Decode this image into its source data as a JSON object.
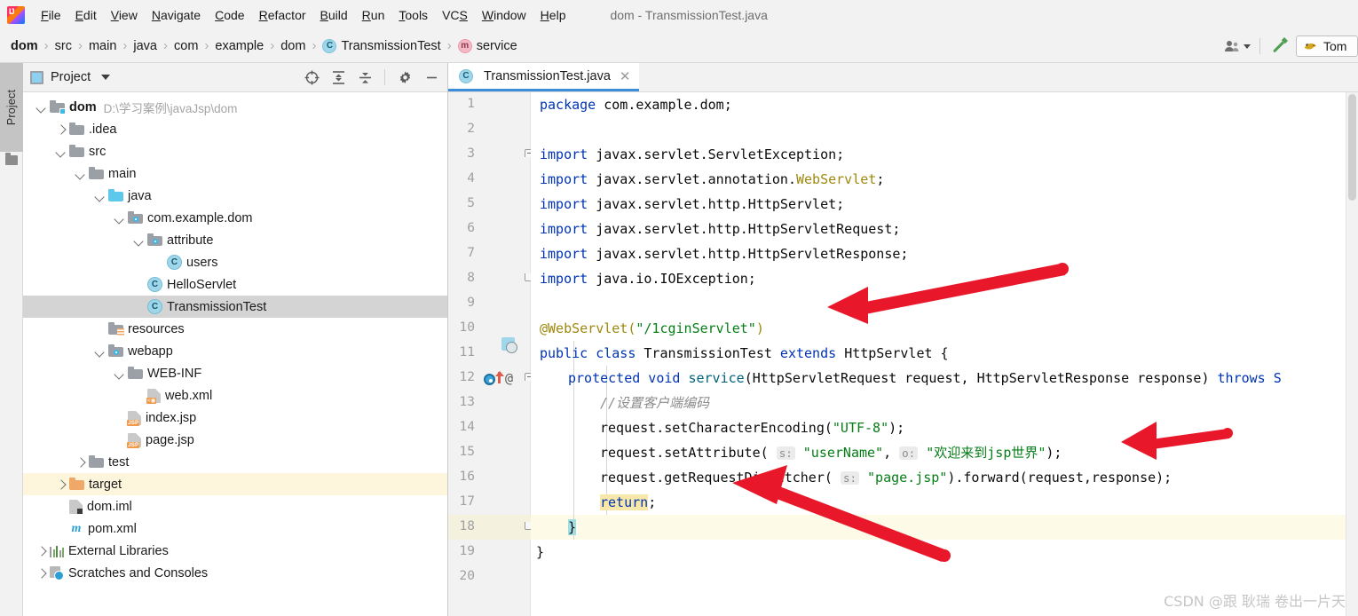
{
  "window": {
    "title": "dom - TransmissionTest.java",
    "app_icon": "intellij-idea-logo"
  },
  "menubar": {
    "items": [
      {
        "label": "File",
        "mnemonic": "F"
      },
      {
        "label": "Edit",
        "mnemonic": "E"
      },
      {
        "label": "View",
        "mnemonic": "V"
      },
      {
        "label": "Navigate",
        "mnemonic": "N"
      },
      {
        "label": "Code",
        "mnemonic": "C"
      },
      {
        "label": "Refactor",
        "mnemonic": "R"
      },
      {
        "label": "Build",
        "mnemonic": "B"
      },
      {
        "label": "Run",
        "mnemonic": "R"
      },
      {
        "label": "Tools",
        "mnemonic": "T"
      },
      {
        "label": "VCS",
        "mnemonic": "S"
      },
      {
        "label": "Window",
        "mnemonic": "W"
      },
      {
        "label": "Help",
        "mnemonic": "H"
      }
    ]
  },
  "breadcrumb": {
    "separator": "›",
    "items": [
      {
        "label": "dom",
        "kind": "module"
      },
      {
        "label": "src",
        "kind": "folder"
      },
      {
        "label": "main",
        "kind": "folder"
      },
      {
        "label": "java",
        "kind": "folder"
      },
      {
        "label": "com",
        "kind": "package"
      },
      {
        "label": "example",
        "kind": "package"
      },
      {
        "label": "dom",
        "kind": "package"
      },
      {
        "label": "TransmissionTest",
        "kind": "class",
        "badge": "C"
      },
      {
        "label": "service",
        "kind": "method",
        "badge": "m"
      }
    ]
  },
  "toolbar_right": {
    "user_icon": "user-silhouette-icon",
    "user_dropdown_icon": "chevron-down-icon",
    "build_icon": "hammer-icon",
    "run_config": {
      "label": "Tom",
      "icon": "tomcat-cat-icon"
    }
  },
  "tool_window_strip": {
    "project_tab": "Project",
    "structure_icon": "folder-icon"
  },
  "project_panel": {
    "title": "Project",
    "title_icon": "project-view-icon",
    "dropdown_icon": "chevron-down-icon",
    "toolbar": [
      {
        "name": "select-opened-file-icon",
        "glyph": "target"
      },
      {
        "name": "expand-all-icon",
        "glyph": "expand"
      },
      {
        "name": "collapse-all-icon",
        "glyph": "collapse"
      },
      {
        "name": "settings-gear-icon",
        "glyph": "gear"
      },
      {
        "name": "hide-panel-icon",
        "glyph": "minus"
      }
    ],
    "tree": [
      {
        "label": "dom",
        "sub": "D:\\学习案例\\javaJsp\\dom",
        "depth": 0,
        "arrow": "down",
        "icon": "module-folder",
        "bold": true,
        "state": "normal"
      },
      {
        "label": ".idea",
        "sub": "",
        "depth": 1,
        "arrow": "right",
        "icon": "folder-gray",
        "bold": false,
        "state": "normal"
      },
      {
        "label": "src",
        "sub": "",
        "depth": 1,
        "arrow": "down",
        "icon": "folder-gray",
        "bold": false,
        "state": "normal"
      },
      {
        "label": "main",
        "sub": "",
        "depth": 2,
        "arrow": "down",
        "icon": "folder-gray",
        "bold": false,
        "state": "normal"
      },
      {
        "label": "java",
        "sub": "",
        "depth": 3,
        "arrow": "down",
        "icon": "folder-blue",
        "bold": false,
        "state": "normal"
      },
      {
        "label": "com.example.dom",
        "sub": "",
        "depth": 4,
        "arrow": "down",
        "icon": "package",
        "bold": false,
        "state": "normal"
      },
      {
        "label": "attribute",
        "sub": "",
        "depth": 5,
        "arrow": "down",
        "icon": "package",
        "bold": false,
        "state": "normal"
      },
      {
        "label": "users",
        "sub": "",
        "depth": 6,
        "arrow": "none",
        "icon": "class",
        "bold": false,
        "state": "normal"
      },
      {
        "label": "HelloServlet",
        "sub": "",
        "depth": 5,
        "arrow": "none",
        "icon": "class",
        "bold": false,
        "state": "normal"
      },
      {
        "label": "TransmissionTest",
        "sub": "",
        "depth": 5,
        "arrow": "none",
        "icon": "class",
        "bold": false,
        "state": "selected"
      },
      {
        "label": "resources",
        "sub": "",
        "depth": 3,
        "arrow": "none",
        "icon": "folder-resources",
        "bold": false,
        "state": "normal"
      },
      {
        "label": "webapp",
        "sub": "",
        "depth": 3,
        "arrow": "down",
        "icon": "folder-webapp",
        "bold": false,
        "state": "normal"
      },
      {
        "label": "WEB-INF",
        "sub": "",
        "depth": 4,
        "arrow": "down",
        "icon": "folder-gray",
        "bold": false,
        "state": "normal"
      },
      {
        "label": "web.xml",
        "sub": "",
        "depth": 5,
        "arrow": "none",
        "icon": "file-xml",
        "bold": false,
        "state": "normal"
      },
      {
        "label": "index.jsp",
        "sub": "",
        "depth": 4,
        "arrow": "none",
        "icon": "file-jsp",
        "bold": false,
        "state": "normal"
      },
      {
        "label": "page.jsp",
        "sub": "",
        "depth": 4,
        "arrow": "none",
        "icon": "file-jsp",
        "bold": false,
        "state": "normal"
      },
      {
        "label": "test",
        "sub": "",
        "depth": 2,
        "arrow": "right",
        "icon": "folder-gray",
        "bold": false,
        "state": "normal"
      },
      {
        "label": "target",
        "sub": "",
        "depth": 1,
        "arrow": "right",
        "icon": "folder-orange",
        "bold": false,
        "state": "highlighted"
      },
      {
        "label": "dom.iml",
        "sub": "",
        "depth": 1,
        "arrow": "none",
        "icon": "file-iml",
        "bold": false,
        "state": "normal"
      },
      {
        "label": "pom.xml",
        "sub": "",
        "depth": 1,
        "arrow": "none",
        "icon": "maven",
        "bold": false,
        "state": "normal"
      },
      {
        "label": "External Libraries",
        "sub": "",
        "depth": 0,
        "arrow": "right",
        "icon": "libraries",
        "bold": false,
        "state": "normal"
      },
      {
        "label": "Scratches and Consoles",
        "sub": "",
        "depth": 0,
        "arrow": "right",
        "icon": "scratches",
        "bold": false,
        "state": "normal"
      }
    ]
  },
  "editor": {
    "tab": {
      "label": "TransmissionTest.java",
      "badge": "C",
      "close_icon": "close-icon"
    },
    "highlighted_line": 18,
    "lines": [
      {
        "n": 1,
        "fold": "none"
      },
      {
        "n": 2,
        "fold": "none"
      },
      {
        "n": 3,
        "fold": "top"
      },
      {
        "n": 4,
        "fold": "none"
      },
      {
        "n": 5,
        "fold": "none"
      },
      {
        "n": 6,
        "fold": "none"
      },
      {
        "n": 7,
        "fold": "none"
      },
      {
        "n": 8,
        "fold": "bot"
      },
      {
        "n": 9,
        "fold": "none"
      },
      {
        "n": 10,
        "fold": "none"
      },
      {
        "n": 11,
        "fold": "none"
      },
      {
        "n": 12,
        "fold": "top"
      },
      {
        "n": 13,
        "fold": "none"
      },
      {
        "n": 14,
        "fold": "none"
      },
      {
        "n": 15,
        "fold": "none"
      },
      {
        "n": 16,
        "fold": "none"
      },
      {
        "n": 17,
        "fold": "none"
      },
      {
        "n": 18,
        "fold": "bot"
      },
      {
        "n": 19,
        "fold": "none"
      },
      {
        "n": 20,
        "fold": "none"
      }
    ],
    "code": {
      "l1": "package com.example.dom;",
      "l3": "import javax.servlet.ServletException;",
      "l4a": "import javax.servlet.annotation.",
      "l4b": "WebServlet",
      "l4c": ";",
      "l5": "import javax.servlet.http.HttpServlet;",
      "l6": "import javax.servlet.http.HttpServletRequest;",
      "l7": "import javax.servlet.http.HttpServletResponse;",
      "l8": "import java.io.IOException;",
      "l10a": "@WebServlet(",
      "l10b": "\"/1cginServlet\"",
      "l10c": ")",
      "l11a": "public class ",
      "l11b": "TransmissionTest",
      "l11c": " extends ",
      "l11d": "HttpServlet {",
      "l12a": "protected void ",
      "l12b": "service",
      "l12c": "(HttpServletRequest request, HttpServletResponse response) ",
      "l12d": "throws ",
      "l12e": "S",
      "l13": "//设置客户端编码",
      "l14a": "request.setCharacterEncoding(",
      "l14b": "\"UTF-8\"",
      "l14c": ");",
      "l15a": "request.setAttribute( ",
      "l15hint1": "s:",
      "l15b": " \"userName\"",
      "l15c": ", ",
      "l15hint2": "o:",
      "l15d": " \"欢迎来到jsp世界\"",
      "l15e": ");",
      "l16a": "request.getRequestDispatcher( ",
      "l16hint": "s:",
      "l16b": " \"page.jsp\"",
      "l16c": ").forward(request,response);",
      "l17a": "return",
      "l17b": ";",
      "l18": "}",
      "l19": "}"
    },
    "gutter_markers": {
      "line11": "class-implemented-icon",
      "line12_override": "overriding-method-icon",
      "line12_annotation": "@"
    }
  },
  "annotations": {
    "arrows": [
      {
        "name": "arrow-to-webservlet-url",
        "points_to": "@WebServlet URL mapping"
      },
      {
        "name": "arrow-to-set-attribute",
        "points_to": "request.setAttribute line"
      },
      {
        "name": "arrow-to-return",
        "points_to": "return statement"
      }
    ],
    "arrow_color": "#e8172a"
  },
  "watermark": {
    "text": "CSDN @跟 耿瑞 卷出一片天"
  },
  "colors": {
    "accent_blue": "#3c8eda",
    "keyword": "#0033b3",
    "string": "#067d17",
    "annotation": "#9e880d",
    "comment": "#8c8c8c",
    "selection": "#d4d4d4",
    "row_highlight": "#fdfae8"
  }
}
